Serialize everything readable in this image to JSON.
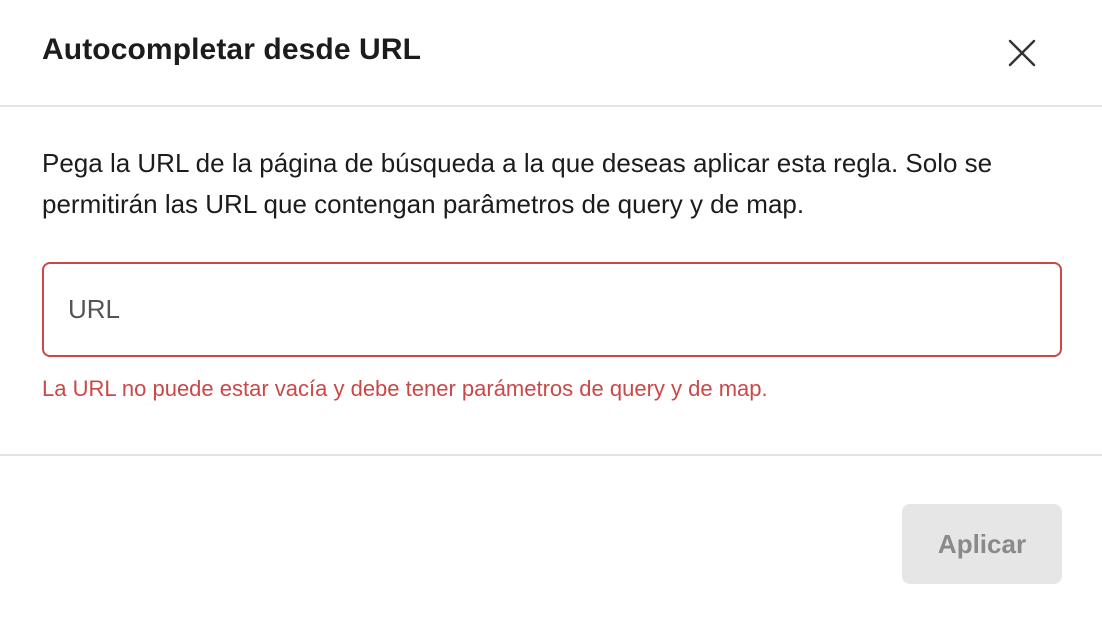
{
  "dialog": {
    "title": "Autocompletar desde URL",
    "close_icon": "close-icon"
  },
  "body": {
    "description": "Pega la URL de la página de búsqueda a la que deseas aplicar esta regla. Solo se permitirán las URL que contengan parâmetros de query y de map.",
    "url_input": {
      "value": "",
      "placeholder": "URL"
    },
    "error_message": "La URL no puede estar vacía y debe tener parámetros de query y de map."
  },
  "footer": {
    "apply_label": "Aplicar"
  },
  "colors": {
    "error": "#c94848",
    "button_disabled_bg": "#e6e6e6",
    "button_disabled_text": "#8a8a8a",
    "divider": "#e4e4e4"
  }
}
